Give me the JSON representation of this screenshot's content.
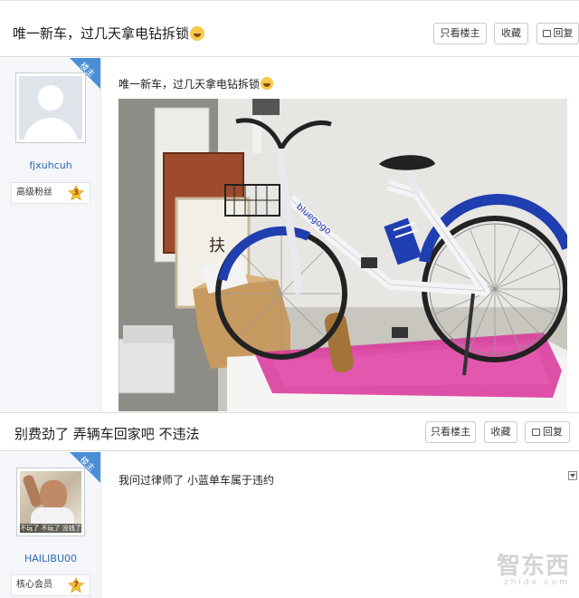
{
  "thread1": {
    "title": "唯一新车，过几天拿电钻拆锁",
    "buttons": {
      "only_owner": "只看楼主",
      "favorite": "收藏",
      "reply": "回复"
    }
  },
  "post1": {
    "owner_badge": "楼主",
    "username": "fjxuhcuh",
    "rank_label": "高级粉丝",
    "rank_level": "3",
    "content": "唯一新车，过几天拿电钻拆锁",
    "photo": {
      "frame_text": "bluegogo",
      "sign_text": "扶"
    }
  },
  "thread2": {
    "title": "别费劲了 弄辆车回家吧 不违法",
    "buttons": {
      "only_owner": "只看楼主",
      "favorite": "收藏",
      "reply": "回复"
    }
  },
  "post2": {
    "owner_badge": "楼主",
    "username": "HAILIBU00",
    "rank_label": "核心会员",
    "rank_level": "7",
    "content": "我问过律师了 小蓝单车属于违约",
    "avatar_caption": "不玩了 不玩了 没钱了"
  },
  "watermark": {
    "main": "智东西",
    "sub": "zhidx.com"
  },
  "colors": {
    "link_blue": "#2f69b4",
    "badge_blue": "#4a8fd6",
    "bike_blue": "#1f3fb0",
    "mat_pink": "#d9339a"
  }
}
